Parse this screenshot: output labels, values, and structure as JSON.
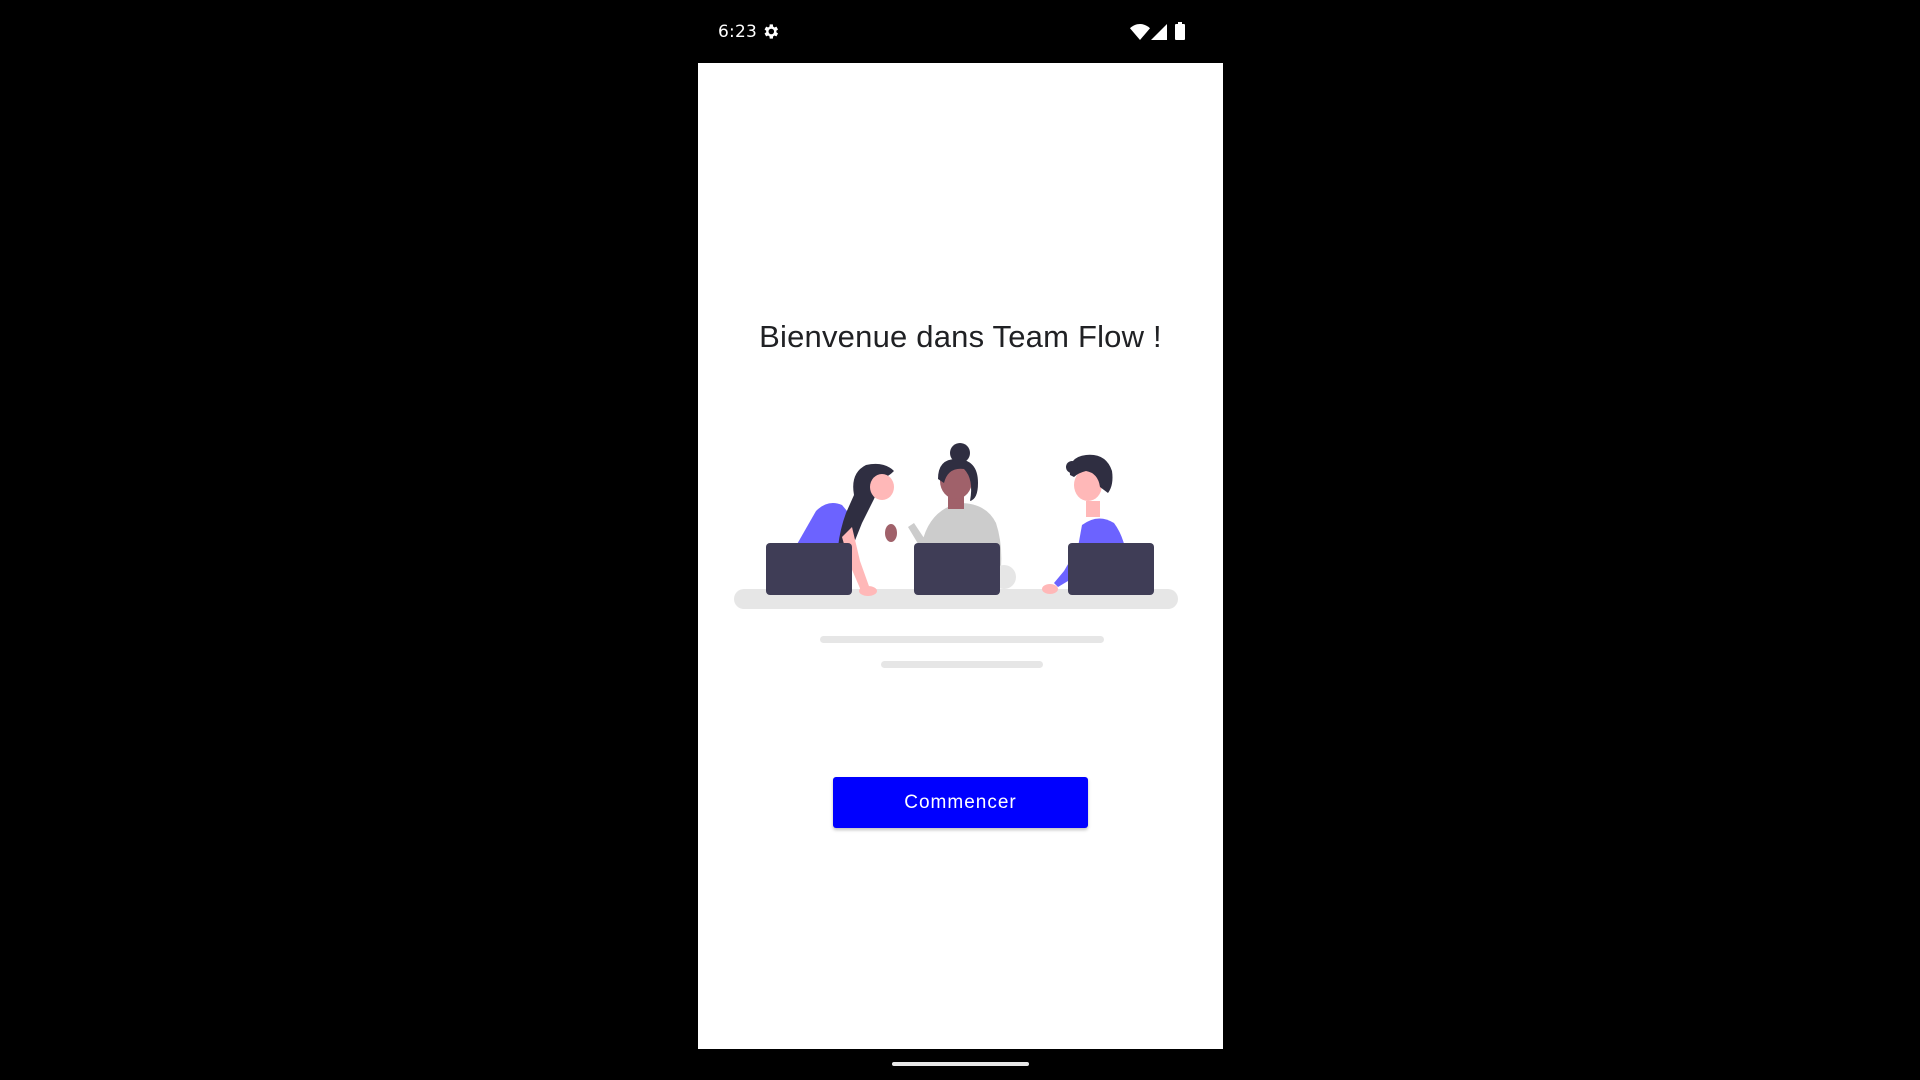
{
  "status_bar": {
    "time": "6:23",
    "icons": [
      "settings-icon",
      "wifi-icon",
      "cell-signal-icon",
      "battery-icon"
    ]
  },
  "welcome": {
    "title": "Bienvenue dans Team Flow !"
  },
  "illustration": {
    "name": "team-working-illustration",
    "colors": {
      "accent": "#6c63ff",
      "laptop": "#3f3d56",
      "hair": "#2f2e41",
      "skin_light": "#ffb8b8",
      "skin_dark": "#a0616a",
      "shirt_gray": "#cccccc",
      "table": "#e6e6e6"
    }
  },
  "actions": {
    "start_label": "Commencer",
    "start_color": "#0000ff"
  }
}
